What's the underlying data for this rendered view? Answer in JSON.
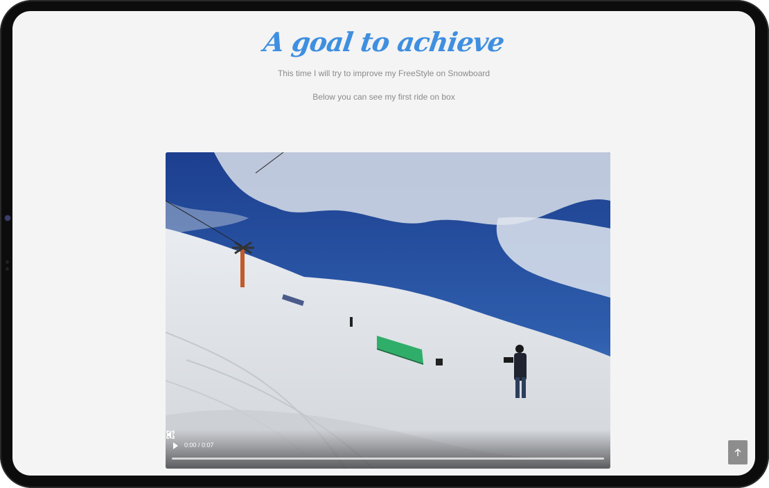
{
  "page": {
    "title": "A goal to achieve",
    "subtitle": "This time I will try to improve my FreeStyle on Snowboard",
    "subtitle2": "Below you can see my first ride on box"
  },
  "video": {
    "time": "0:00 / 0:07",
    "progress": 0
  },
  "icons": {
    "play": "play-icon",
    "volume": "volume-icon",
    "fullscreen": "fullscreen-icon",
    "more": "more-vertical-icon",
    "scroll_top": "arrow-up-icon"
  },
  "colors": {
    "title": "#3f8fe0",
    "text": "#8a8a8a",
    "background": "#f4f4f4",
    "scroll_button": "#8d8d8d"
  }
}
